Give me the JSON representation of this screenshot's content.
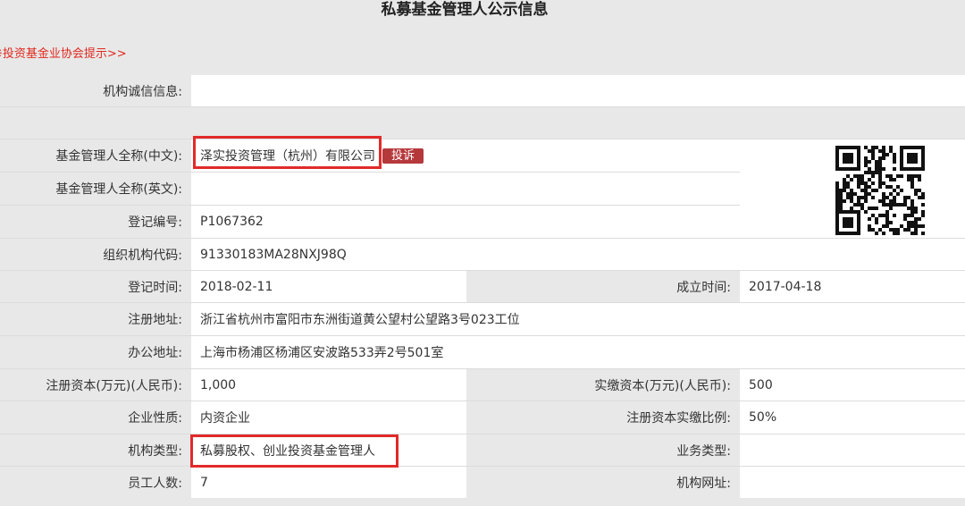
{
  "header": {
    "title": "私募基金管理人公示信息",
    "notice_link": "※投资基金业协会提示>>"
  },
  "credit_row": {
    "label": "机构诚信信息:",
    "value": ""
  },
  "fields": {
    "name_cn": {
      "label": "基金管理人全称(中文):",
      "value": "泽实投资管理（杭州）有限公司"
    },
    "complain_button": "投诉",
    "name_en": {
      "label": "基金管理人全称(英文):",
      "value": ""
    },
    "reg_no": {
      "label": "登记编号:",
      "value": "P1067362"
    },
    "org_code": {
      "label": "组织机构代码:",
      "value": "91330183MA28NXJ98Q"
    },
    "reg_time": {
      "label": "登记时间:",
      "value": "2018-02-11"
    },
    "found_time": {
      "label": "成立时间:",
      "value": "2017-04-18"
    },
    "reg_address": {
      "label": "注册地址:",
      "value": "浙江省杭州市富阳市东洲街道黄公望村公望路3号023工位"
    },
    "office_address": {
      "label": "办公地址:",
      "value": "上海市杨浦区杨浦区安波路533弄2号501室"
    },
    "reg_capital": {
      "label": "注册资本(万元)(人民币):",
      "value": "1,000"
    },
    "paid_capital": {
      "label": "实缴资本(万元)(人民币):",
      "value": "500"
    },
    "nature": {
      "label": "企业性质:",
      "value": "内资企业"
    },
    "paid_ratio": {
      "label": "注册资本实缴比例:",
      "value": "50%"
    },
    "org_type": {
      "label": "机构类型:",
      "value": "私募股权、创业投资基金管理人"
    },
    "biz_type": {
      "label": "业务类型:",
      "value": ""
    },
    "staff": {
      "label": "员工人数:",
      "value": "7"
    },
    "website": {
      "label": "机构网址:",
      "value": ""
    }
  },
  "colors": {
    "label_bg": "#e8e8e8",
    "highlight_border": "#e22a2a",
    "complain_bg": "#b5383b",
    "notice_text": "#e0281e"
  },
  "icons": {
    "qr": "qr-code-icon"
  }
}
